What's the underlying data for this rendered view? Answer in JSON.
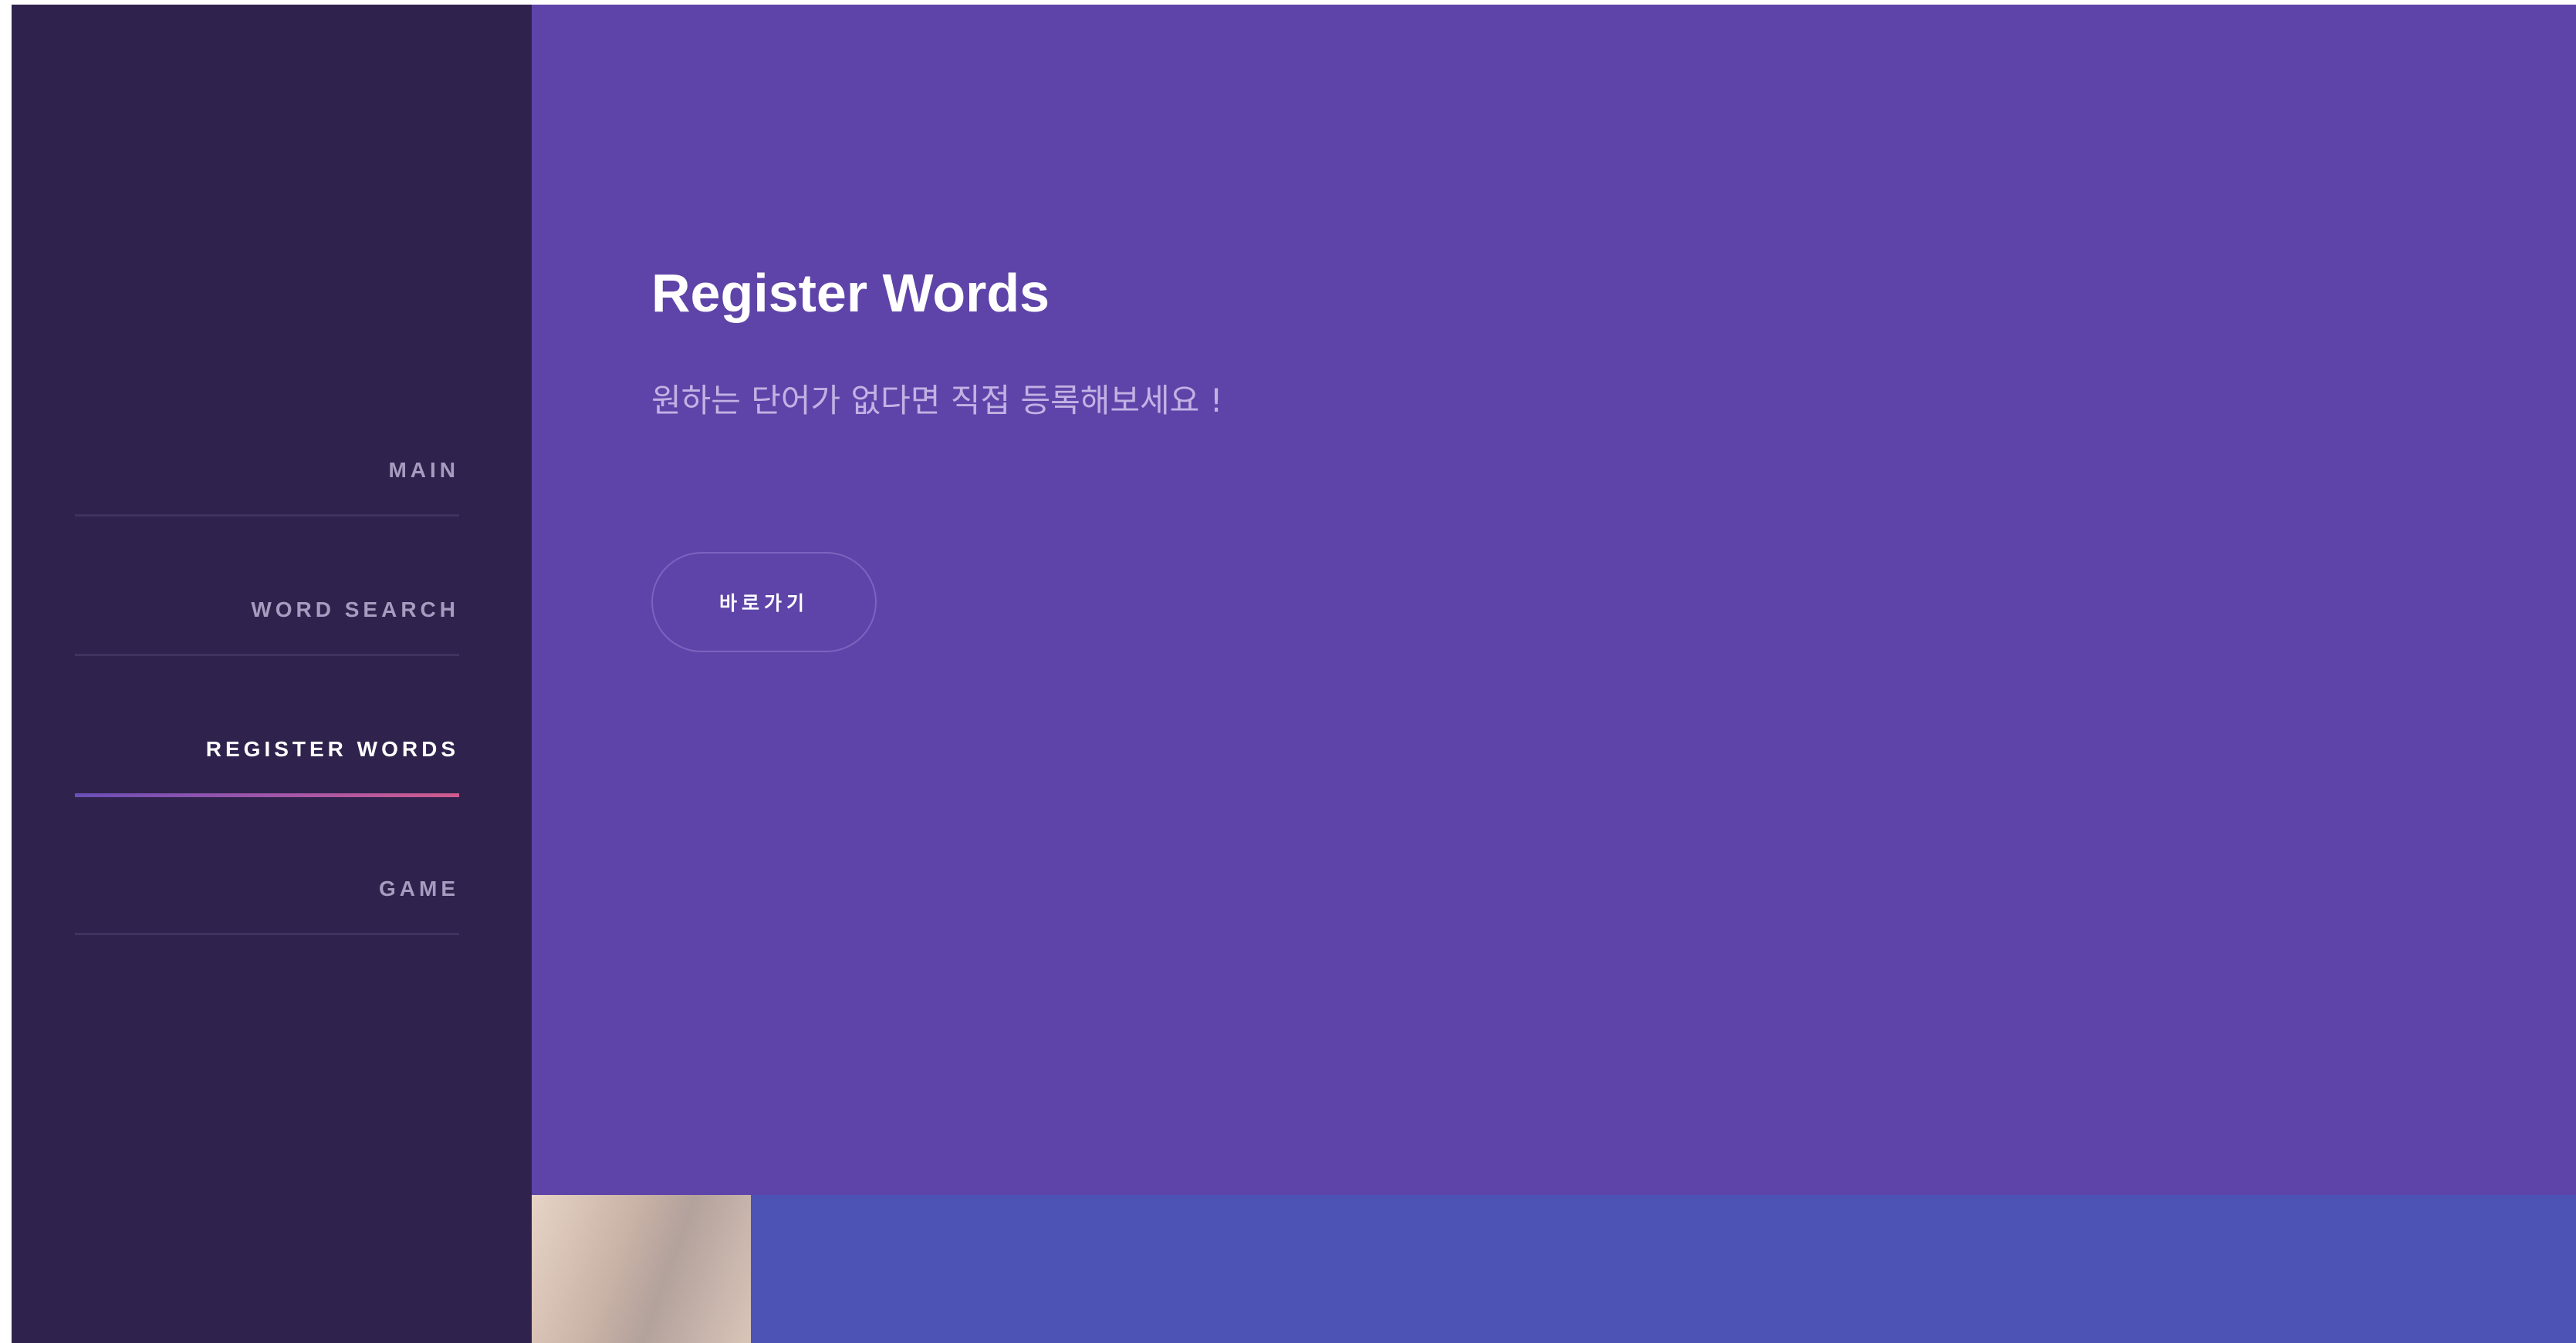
{
  "sidebar": {
    "items": [
      {
        "label": "MAIN",
        "active": false
      },
      {
        "label": "WORD SEARCH",
        "active": false
      },
      {
        "label": "REGISTER WORDS",
        "active": true
      },
      {
        "label": "GAME",
        "active": false
      }
    ]
  },
  "main": {
    "title": "Register Words",
    "subtitle": "원하는 단어가 없다면 직접 등록해보세요 !",
    "button_label": "바로가기"
  },
  "colors": {
    "sidebar_bg": "#2f234d",
    "main_bg": "#5e44a8",
    "bottom_bg": "#4d52b5",
    "active_underline_start": "#6a4fb8",
    "active_underline_end": "#d05b8e"
  }
}
